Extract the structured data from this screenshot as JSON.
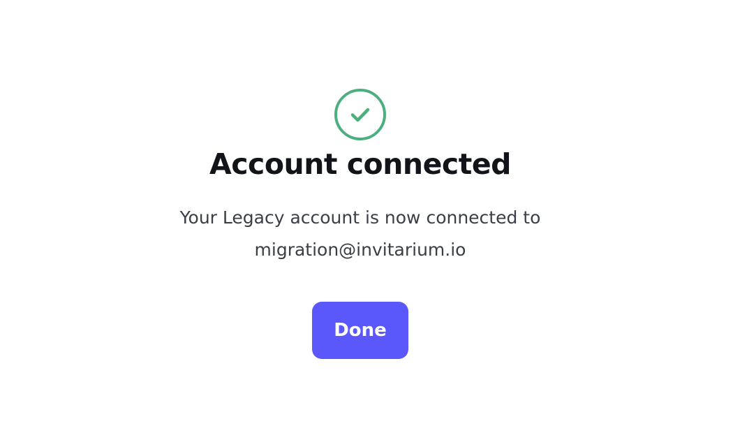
{
  "dialog": {
    "icon": "check-circle-icon",
    "title": "Account connected",
    "message_line1": "Your Legacy account is now connected to",
    "message_line2": "migration@invitarium.io",
    "done_label": "Done"
  },
  "colors": {
    "success": "#4bb07e",
    "primary_button": "#5a57fb",
    "title_text": "#111418",
    "body_text": "#3a3f47",
    "background": "#ffffff"
  }
}
